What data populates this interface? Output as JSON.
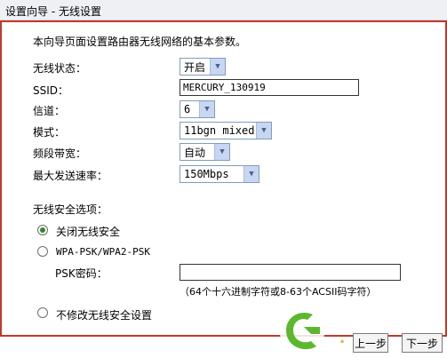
{
  "window": {
    "title": "设置向导 - 无线设置"
  },
  "description": "本向导页面设置路由器无线网络的基本参数。",
  "fields": {
    "wireless_status": {
      "label": "无线状态：",
      "value": "开启"
    },
    "ssid": {
      "label": "SSID：",
      "value": "MERCURY_130919"
    },
    "channel": {
      "label": "信道：",
      "value": "6"
    },
    "mode": {
      "label": "模式：",
      "value": "11bgn mixed"
    },
    "bandwidth": {
      "label": "频段带宽：",
      "value": "自动"
    },
    "max_rate": {
      "label": "最大发送速率：",
      "value": "150Mbps"
    }
  },
  "security": {
    "title": "无线安全选项：",
    "options": [
      {
        "label": "关闭无线安全",
        "selected": true
      },
      {
        "label": "WPA-PSK/WPA2-PSK",
        "selected": false
      },
      {
        "label": "不修改无线安全设置",
        "selected": false
      }
    ],
    "psk_label": "PSK密码：",
    "psk_value": "",
    "psk_hint": "（64个十六进制字符或8-63个ACSII码字符）"
  },
  "buttons": {
    "back": "上一步",
    "next": "下一步"
  },
  "colors": {
    "accent_red": "#c0392b",
    "radio_selected": "#2a8a2a",
    "select_arrow_bg": "#c7d6f2"
  },
  "icons": {
    "select_arrow": "chevron-down-icon",
    "watermark": "logo-watermark-icon"
  }
}
